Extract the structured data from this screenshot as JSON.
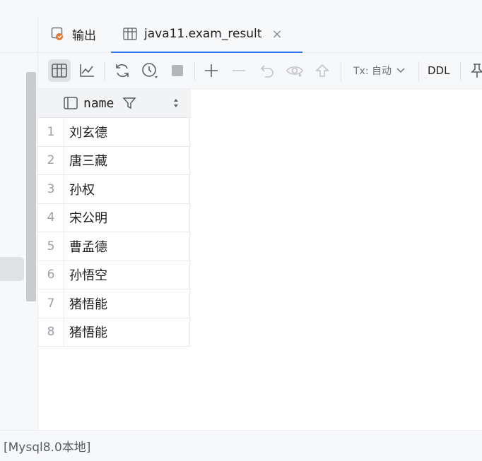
{
  "tabs": {
    "output_label": "输出",
    "result_label": "java11.exam_result",
    "close_glyph": "×"
  },
  "toolbar": {
    "tx_label": "Tx: 自动",
    "ddl_label": "DDL",
    "icons": [
      "table-view-icon",
      "chart-icon",
      "refresh-icon",
      "history-icon",
      "stop-icon",
      "add-row-icon",
      "delete-row-icon",
      "revert-icon",
      "preview-icon",
      "submit-icon",
      "pin-icon"
    ]
  },
  "grid": {
    "column": "name",
    "rows": [
      {
        "num": "1",
        "name": "刘玄德"
      },
      {
        "num": "2",
        "name": "唐三藏"
      },
      {
        "num": "3",
        "name": "孙权"
      },
      {
        "num": "4",
        "name": "宋公明"
      },
      {
        "num": "5",
        "name": "曹孟德"
      },
      {
        "num": "6",
        "name": "孙悟空"
      },
      {
        "num": "7",
        "name": "猪悟能"
      },
      {
        "num": "8",
        "name": "猪悟能"
      }
    ]
  },
  "status": {
    "text": "[Mysql8.0本地]"
  },
  "colors": {
    "accent": "#3574f0",
    "background": "#f7f8fa",
    "output_icon": "#e8742e"
  }
}
